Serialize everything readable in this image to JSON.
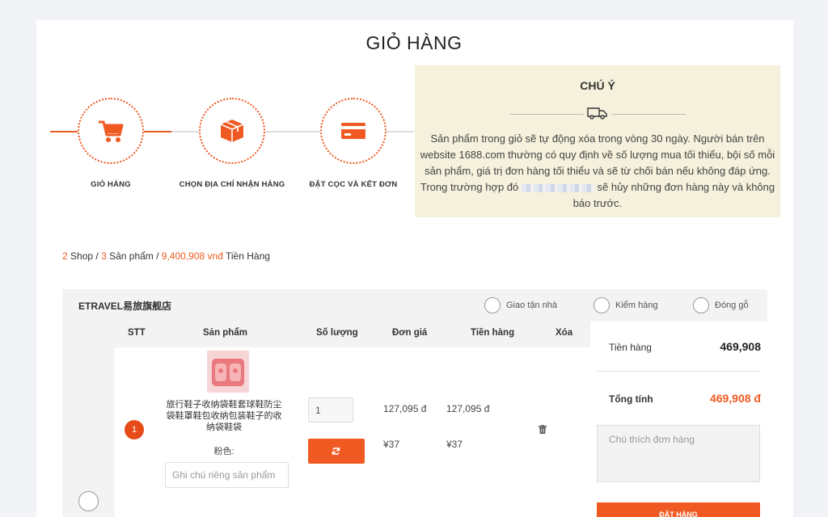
{
  "page": {
    "title": "GIỎ HÀNG"
  },
  "colors": {
    "accent": "#f05a22",
    "notice_bg": "#f5f1dc"
  },
  "steps": [
    {
      "label": "GIỎ HÀNG",
      "icon": "cart-icon"
    },
    {
      "label": "CHỌN ĐỊA CHỈ NHẬN HÀNG",
      "icon": "box-icon"
    },
    {
      "label": "ĐẶT CỌC VÀ KẾT ĐƠN",
      "icon": "credit-card-icon"
    }
  ],
  "notice": {
    "title": "CHÚ Ý",
    "icon": "truck-icon",
    "text_before": "Sản phẩm trong giỏ sẽ tự động xóa trong vòng 30 ngày. Người bán trên website 1688.com thường có quy định về số lượng mua tối thiểu, bội số mỗi sản phẩm, giá trị đơn hàng tối thiểu và sẽ từ chối bán nếu không đáp ứng. Trong trường hợp đó",
    "text_after": " sẽ hủy những đơn hàng này và không báo trước."
  },
  "summary": {
    "shop_count": "2",
    "shop_label": " Shop / ",
    "product_count": "3",
    "product_label": " Sản phẩm / ",
    "total": "9,400,908 vnđ",
    "total_label": " Tiền Hàng"
  },
  "shop": {
    "name": "ETRAVEL易旅旗舰店",
    "options": [
      "Giao tận nhà",
      "Kiểm hàng",
      "Đóng gỗ"
    ]
  },
  "table": {
    "headers": {
      "stt": "STT",
      "product": "Sản phẩm",
      "qty": "Số lượng",
      "unit_price": "Đơn giá",
      "amount": "Tiền hàng",
      "delete": "Xóa"
    }
  },
  "item": {
    "index": "1",
    "name": "旅行鞋子收纳袋鞋套球鞋防尘袋鞋罩鞋包收纳包装鞋子的收纳袋鞋袋",
    "color": "粉色:",
    "note_placeholder": "Ghi chú riêng sản phẩm",
    "quantity": "1",
    "unit_price_vnd": "127,095 đ",
    "amount_vnd": "127,095 đ",
    "unit_price_cny": "¥37",
    "amount_cny": "¥37"
  },
  "side": {
    "subtotal_label": "Tiền hàng",
    "subtotal_value": "469,908",
    "total_label": "Tổng tính",
    "total_value": "469,908 đ",
    "note_placeholder": "Chú thích đơn hàng",
    "order_button": "ĐẶT HÀNG"
  }
}
